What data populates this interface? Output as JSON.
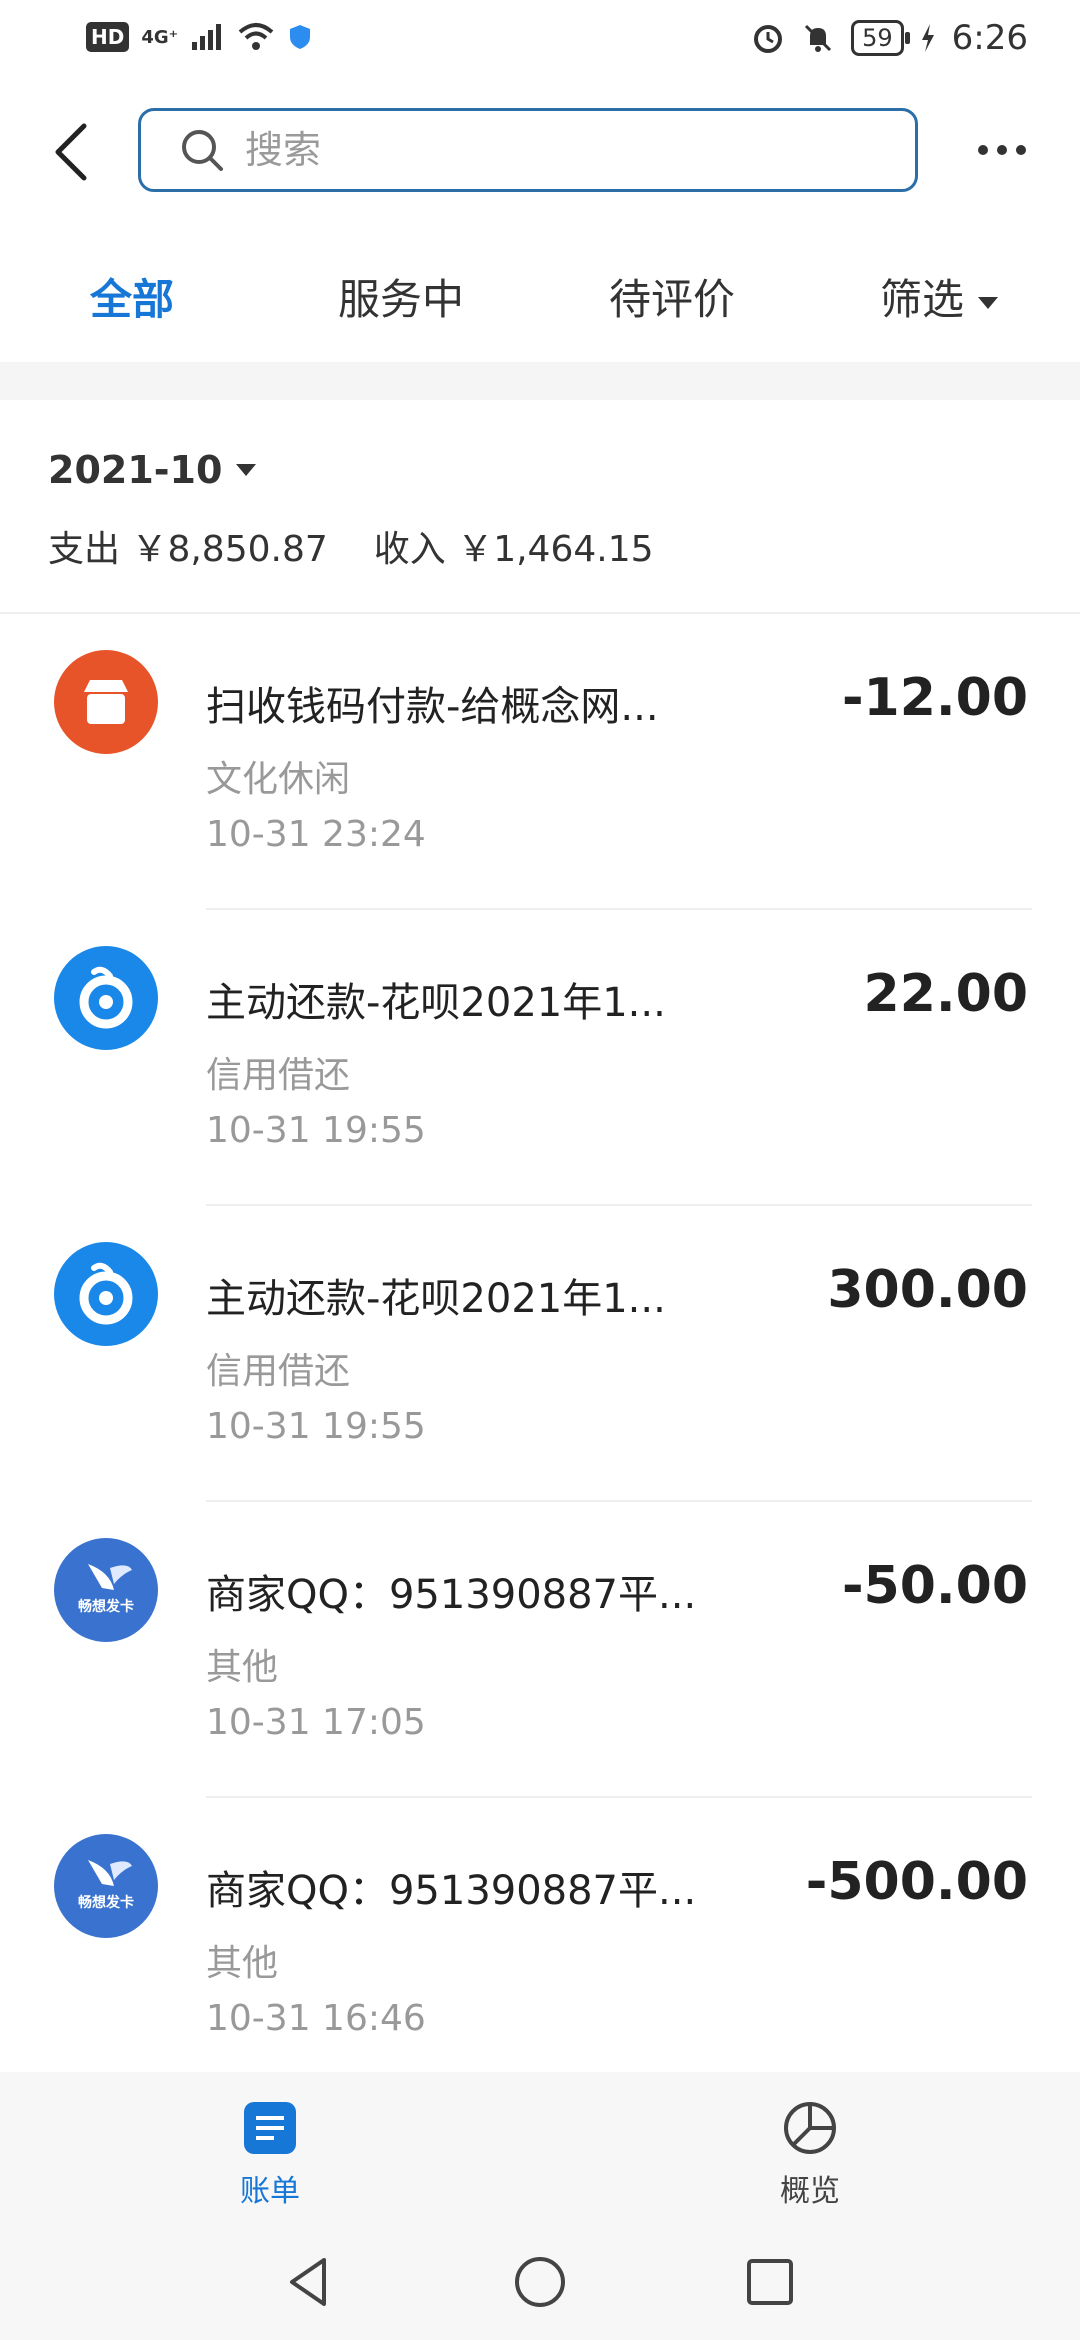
{
  "status_bar": {
    "hd": "HD",
    "network": "4G⁺",
    "battery": "59",
    "time": "6:26"
  },
  "search": {
    "placeholder": "搜索"
  },
  "tabs": [
    {
      "label": "全部",
      "active": true
    },
    {
      "label": "服务中",
      "active": false
    },
    {
      "label": "待评价",
      "active": false
    },
    {
      "label": "筛选",
      "active": false
    }
  ],
  "summary": {
    "month": "2021-10",
    "expense": "支出 ￥8,850.87",
    "income": "收入 ￥1,464.15"
  },
  "transactions": [
    {
      "icon": "store-icon",
      "title": "扫收钱码付款-给概念网...",
      "category": "文化休闲",
      "time": "10-31  23:24",
      "amount": "-12.00"
    },
    {
      "icon": "huabei-icon",
      "title": "主动还款-花呗2021年1...",
      "category": "信用借还",
      "time": "10-31  19:55",
      "amount": "22.00"
    },
    {
      "icon": "huabei-icon",
      "title": "主动还款-花呗2021年1...",
      "category": "信用借还",
      "time": "10-31  19:55",
      "amount": "300.00"
    },
    {
      "icon": "changxiang-icon",
      "title": "商家QQ：951390887平...",
      "category": "其他",
      "time": "10-31  17:05",
      "amount": "-50.00"
    },
    {
      "icon": "changxiang-icon",
      "title": "商家QQ：951390887平...",
      "category": "其他",
      "time": "10-31  16:46",
      "amount": "-500.00"
    }
  ],
  "merchant_logo_text": "畅想发卡",
  "bottom_nav": {
    "bill": "账单",
    "overview": "概览"
  },
  "colors": {
    "accent": "#1677d6",
    "search_border": "#2b6ea8",
    "store": "#e8542a",
    "huabei": "#1a88e8",
    "changxiang": "#3a73cf"
  }
}
